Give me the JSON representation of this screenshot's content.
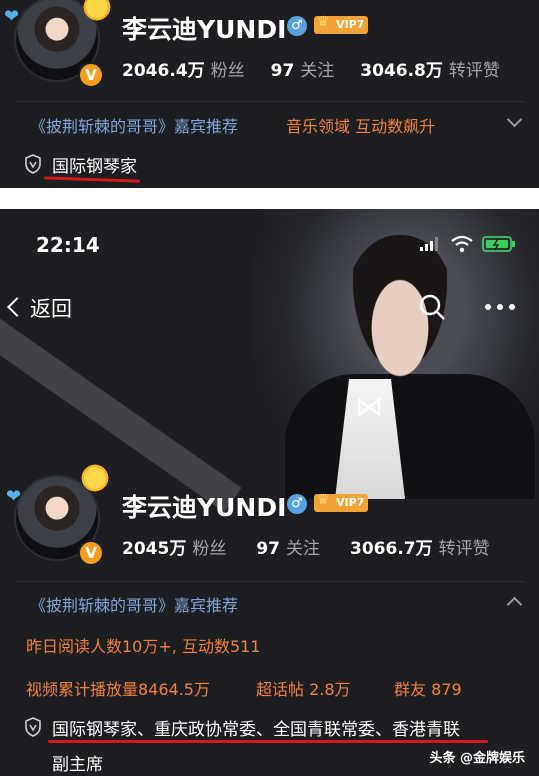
{
  "top": {
    "name": "李云迪YUNDI",
    "vip_label": "VIP7",
    "followers": "2046.4万",
    "followers_label": "粉丝",
    "following": "97",
    "following_label": "关注",
    "reposts": "3046.8万",
    "reposts_label": "转评赞",
    "tag_show": "《披荆斩棘的哥哥》嘉宾推荐",
    "tag_music": "音乐领域 互动数飙升",
    "credential": "国际钢琴家"
  },
  "bottom": {
    "status_time": "22:14",
    "back_label": "返回",
    "name": "李云迪YUNDI",
    "vip_label": "VIP7",
    "followers": "2045万",
    "followers_label": "粉丝",
    "following": "97",
    "following_label": "关注",
    "reposts": "3066.7万",
    "reposts_label": "转评赞",
    "tag_show": "《披荆斩棘的哥哥》嘉宾推荐",
    "read_stats": "昨日阅读人数10万+, 互动数511",
    "video_stats": "视频累计播放量8464.5万",
    "super_topic": "超话帖 2.8万",
    "group_friends": "群友 879",
    "credential_line1": "国际钢琴家、重庆政协常委、全国青联常委、香港青联",
    "credential_line2": "副主席"
  },
  "footer": {
    "prefix": "头条",
    "handle": "@金牌娱乐"
  },
  "colors": {
    "panel_bg": "#1d1e22",
    "accent_orange": "#f0803a",
    "tag_blue": "#7fa6d9",
    "underline_red": "#d11a1a",
    "vbadge": "#f59d1e"
  },
  "icons": [
    "heart-icon",
    "sun-icon",
    "verified-v-icon",
    "male-gender-icon",
    "vip-crown-icon",
    "shield-icon",
    "chevron-down-icon",
    "chevron-up-icon",
    "back-arrow-icon",
    "search-icon",
    "more-icon",
    "signal-icon",
    "wifi-icon",
    "battery-icon"
  ]
}
